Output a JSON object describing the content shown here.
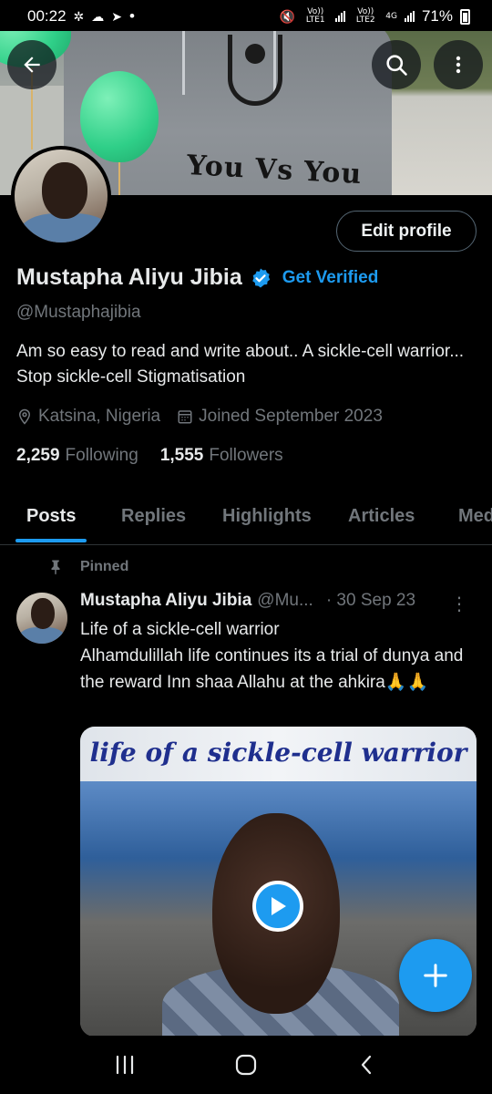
{
  "status_bar": {
    "time": "00:22",
    "dot": "•",
    "sim1_label": "Vo)) LTE1",
    "sim2_label": "Vo)) LTE2",
    "network": "4G",
    "battery": "71%"
  },
  "banner": {
    "shirt_text": "You Vs You"
  },
  "header_actions": {
    "back": "back-arrow-icon",
    "search": "search-icon",
    "more": "more-vertical-icon"
  },
  "profile": {
    "edit_button": "Edit profile",
    "name": "Mustapha Aliyu Jibia",
    "get_verified": "Get Verified",
    "handle": "@Mustaphajibia",
    "bio": "Am so easy to read and write about.. A sickle-cell warrior... Stop sickle-cell Stigmatisation",
    "location": "Katsina, Nigeria",
    "joined": "Joined September 2023",
    "following_count": "2,259",
    "following_label": "Following",
    "followers_count": "1,555",
    "followers_label": "Followers"
  },
  "tabs": [
    {
      "label": "Posts",
      "active": true
    },
    {
      "label": "Replies",
      "active": false
    },
    {
      "label": "Highlights",
      "active": false
    },
    {
      "label": "Articles",
      "active": false
    },
    {
      "label": "Med",
      "active": false
    }
  ],
  "pinned_post": {
    "pinned_label": "Pinned",
    "author_name": "Mustapha Aliyu Jibia",
    "author_handle": "@Mu...",
    "date": "· 30 Sep 23",
    "more": "⋮",
    "text": "Life of a sickle-cell warrior\nAlhamdulillah life continues its a trial of dunya and the reward Inn shaa Allahu at the ahkira🙏🙏",
    "media_title": "life of a sickle-cell warrior"
  },
  "colors": {
    "accent": "#1d9bf0",
    "background": "#000000",
    "muted": "#71767b"
  }
}
